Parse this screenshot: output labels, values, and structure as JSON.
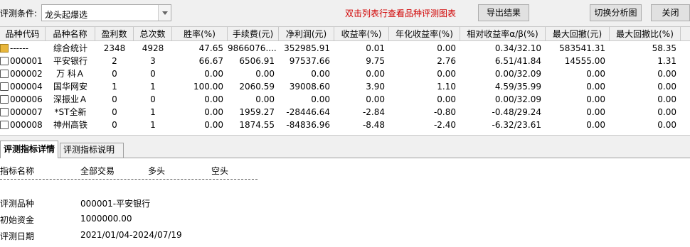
{
  "toolbar": {
    "condition_label": "评测条件:",
    "condition_value": "龙头起爆选",
    "hint": "双击列表行查看品种评测图表",
    "export_label": "导出结果",
    "switch_label": "切换分析图",
    "close_label": "关闭"
  },
  "table": {
    "headers": [
      "品种代码",
      "品种名称",
      "盈利数",
      "总次数",
      "胜率(%)",
      "手续费(元)",
      "净利润(元)",
      "收益率(%)",
      "年化收益率(%)",
      "相对收益率α/β(%)",
      "最大回撤(元)",
      "最大回撤比(%)"
    ],
    "rows": [
      [
        "------",
        "综合统计",
        "2348",
        "4928",
        "47.65",
        "9866076....",
        "352985.91",
        "0.01",
        "0.00",
        "0.34/32.10",
        "583541.31",
        "58.35"
      ],
      [
        "000001",
        "平安银行",
        "2",
        "3",
        "66.67",
        "6506.91",
        "97537.66",
        "9.75",
        "2.76",
        "6.51/41.84",
        "14555.00",
        "1.31"
      ],
      [
        "000002",
        "万 科Ａ",
        "0",
        "0",
        "0.00",
        "0.00",
        "0.00",
        "0.00",
        "0.00",
        "0.00/32.09",
        "0.00",
        "0.00"
      ],
      [
        "000004",
        "国华网安",
        "1",
        "1",
        "100.00",
        "2060.59",
        "39008.60",
        "3.90",
        "1.10",
        "4.59/35.99",
        "0.00",
        "0.00"
      ],
      [
        "000006",
        "深振业Ａ",
        "0",
        "0",
        "0.00",
        "0.00",
        "0.00",
        "0.00",
        "0.00",
        "0.00/32.09",
        "0.00",
        "0.00"
      ],
      [
        "000007",
        "*ST全新",
        "0",
        "1",
        "0.00",
        "1959.27",
        "-28446.64",
        "-2.84",
        "-0.80",
        "-0.48/29.24",
        "0.00",
        "0.00"
      ],
      [
        "000008",
        "神州高铁",
        "0",
        "1",
        "0.00",
        "1874.55",
        "-84836.96",
        "-8.48",
        "-2.40",
        "-6.32/23.61",
        "0.00",
        "0.00"
      ]
    ]
  },
  "tabs": {
    "detail": "评测指标详情",
    "explain": "评测指标说明"
  },
  "detail": {
    "col_name": "指标名称",
    "col_all": "全部交易",
    "col_long": "多头",
    "col_short": "空头",
    "items": [
      {
        "label": "评测品种",
        "value": "000001-平安银行"
      },
      {
        "label": "初始资金",
        "value": "1000000.00"
      },
      {
        "label": "评测日期",
        "value": "2021/01/04-2024/07/19"
      }
    ]
  },
  "colors": {
    "hint": "#d00000",
    "folder_icon": "#e8b63c"
  }
}
